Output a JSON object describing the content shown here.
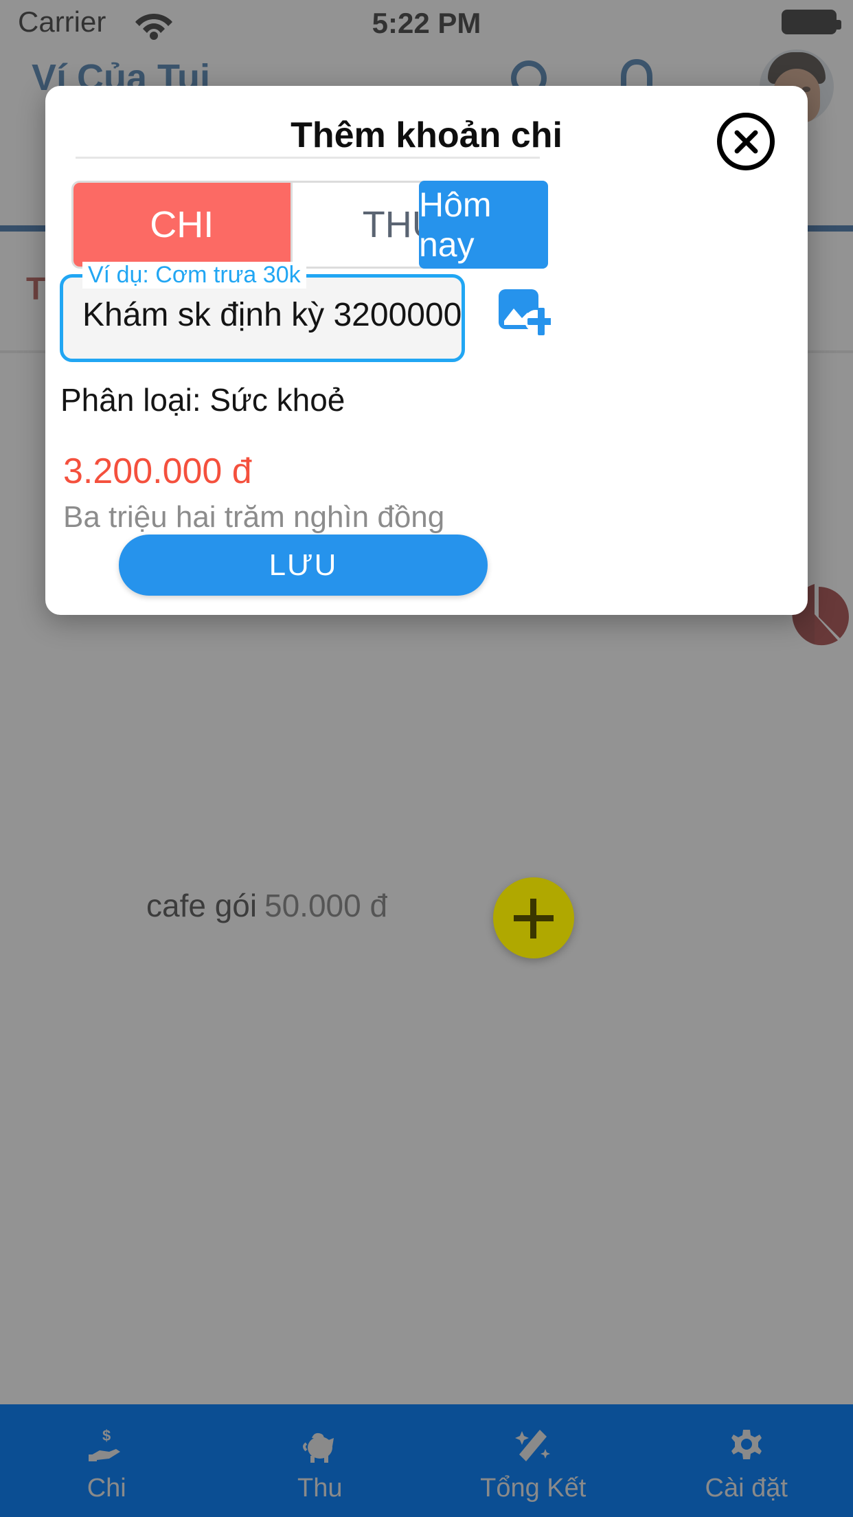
{
  "status_bar": {
    "carrier": "Carrier",
    "time": "5:22 PM",
    "wifi_icon": "wifi-icon",
    "battery_icon": "battery-full-icon"
  },
  "app_header": {
    "title": "Ví Của Tui",
    "search_icon": "search-icon",
    "bell_icon": "notification-bell-icon",
    "avatar_alt": "user-avatar"
  },
  "background": {
    "summary_label": "Tổ",
    "pie_icon": "pie-chart-icon",
    "list_item": {
      "name": "cafe gói",
      "amount": "50.000 đ"
    },
    "fab_label": "+"
  },
  "bottom_nav": {
    "items": [
      {
        "label": "Chi",
        "icon": "hand-money-icon"
      },
      {
        "label": "Thu",
        "icon": "piggy-bank-icon"
      },
      {
        "label": "Tổng Kết",
        "icon": "magic-wand-icon"
      },
      {
        "label": "Cài đặt",
        "icon": "gear-icon"
      }
    ]
  },
  "modal": {
    "title": "Thêm khoản chi",
    "close_icon": "close-circle-icon",
    "segments": [
      {
        "label": "CHI",
        "active": true
      },
      {
        "label": "THU",
        "active": false
      }
    ],
    "today_button": "Hôm nay",
    "input": {
      "label": "Ví dụ: Cơm trưa 30k",
      "value": "Khám sk định kỳ 3200000",
      "placeholder": "Ví dụ: Cơm trưa 30k"
    },
    "photo_button_icon": "add-photo-icon",
    "category_line": "Phân loại: Sức khoẻ",
    "amount_value": "3.200.000 đ",
    "amount_words": "Ba triệu hai trăm nghìn đồng",
    "save_button": "LƯU"
  },
  "colors": {
    "brand_blue": "#1c5d9c",
    "accent_blue": "#2693ec",
    "field_blue": "#21a6f3",
    "expense_red": "#fc6a64",
    "amount_red": "#f4503d",
    "nav_blue": "#0b4e93",
    "fab_yellow": "#b0a800"
  }
}
